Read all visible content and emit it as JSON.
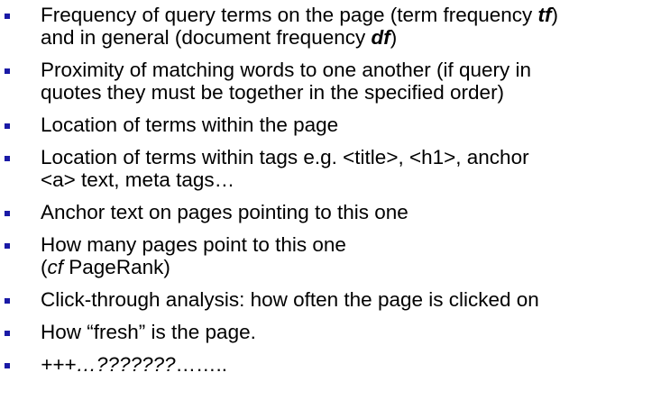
{
  "bullet_color": "#1a1aa6",
  "bullets": [
    {
      "lines": [
        [
          {
            "t": "Frequency of query terms on the page (term frequency "
          },
          {
            "t": "tf",
            "bi": true
          },
          {
            "t": ")"
          }
        ],
        [
          {
            "t": "and in general (document frequency "
          },
          {
            "t": "df",
            "bi": true
          },
          {
            "t": ")"
          }
        ]
      ]
    },
    {
      "lines": [
        [
          {
            "t": "Proximity of matching words to one another (if query in"
          }
        ],
        [
          {
            "t": "quotes they must be together in the specified order)"
          }
        ]
      ]
    },
    {
      "lines": [
        [
          {
            "t": "Location of terms within the page"
          }
        ]
      ]
    },
    {
      "lines": [
        [
          {
            "t": "Location of terms within tags e.g. <title>, <h1>, anchor"
          }
        ],
        [
          {
            "t": "<a> text, meta tags…"
          }
        ]
      ]
    },
    {
      "lines": [
        [
          {
            "t": "Anchor text on pages pointing to this one"
          }
        ]
      ]
    },
    {
      "lines": [
        [
          {
            "t": "How many pages point to this one"
          }
        ],
        [
          {
            "t": "("
          },
          {
            "t": "cf",
            "i": true
          },
          {
            "t": " PageRank)"
          }
        ]
      ]
    },
    {
      "lines": [
        [
          {
            "t": "Click-through analysis: how often the page is clicked on"
          }
        ]
      ]
    },
    {
      "lines": [
        [
          {
            "t": "How “fresh” is the page."
          }
        ]
      ]
    },
    {
      "lines": [
        [
          {
            "t": "+++…???????",
            "i": true
          },
          {
            "t": "…….."
          }
        ]
      ]
    }
  ]
}
